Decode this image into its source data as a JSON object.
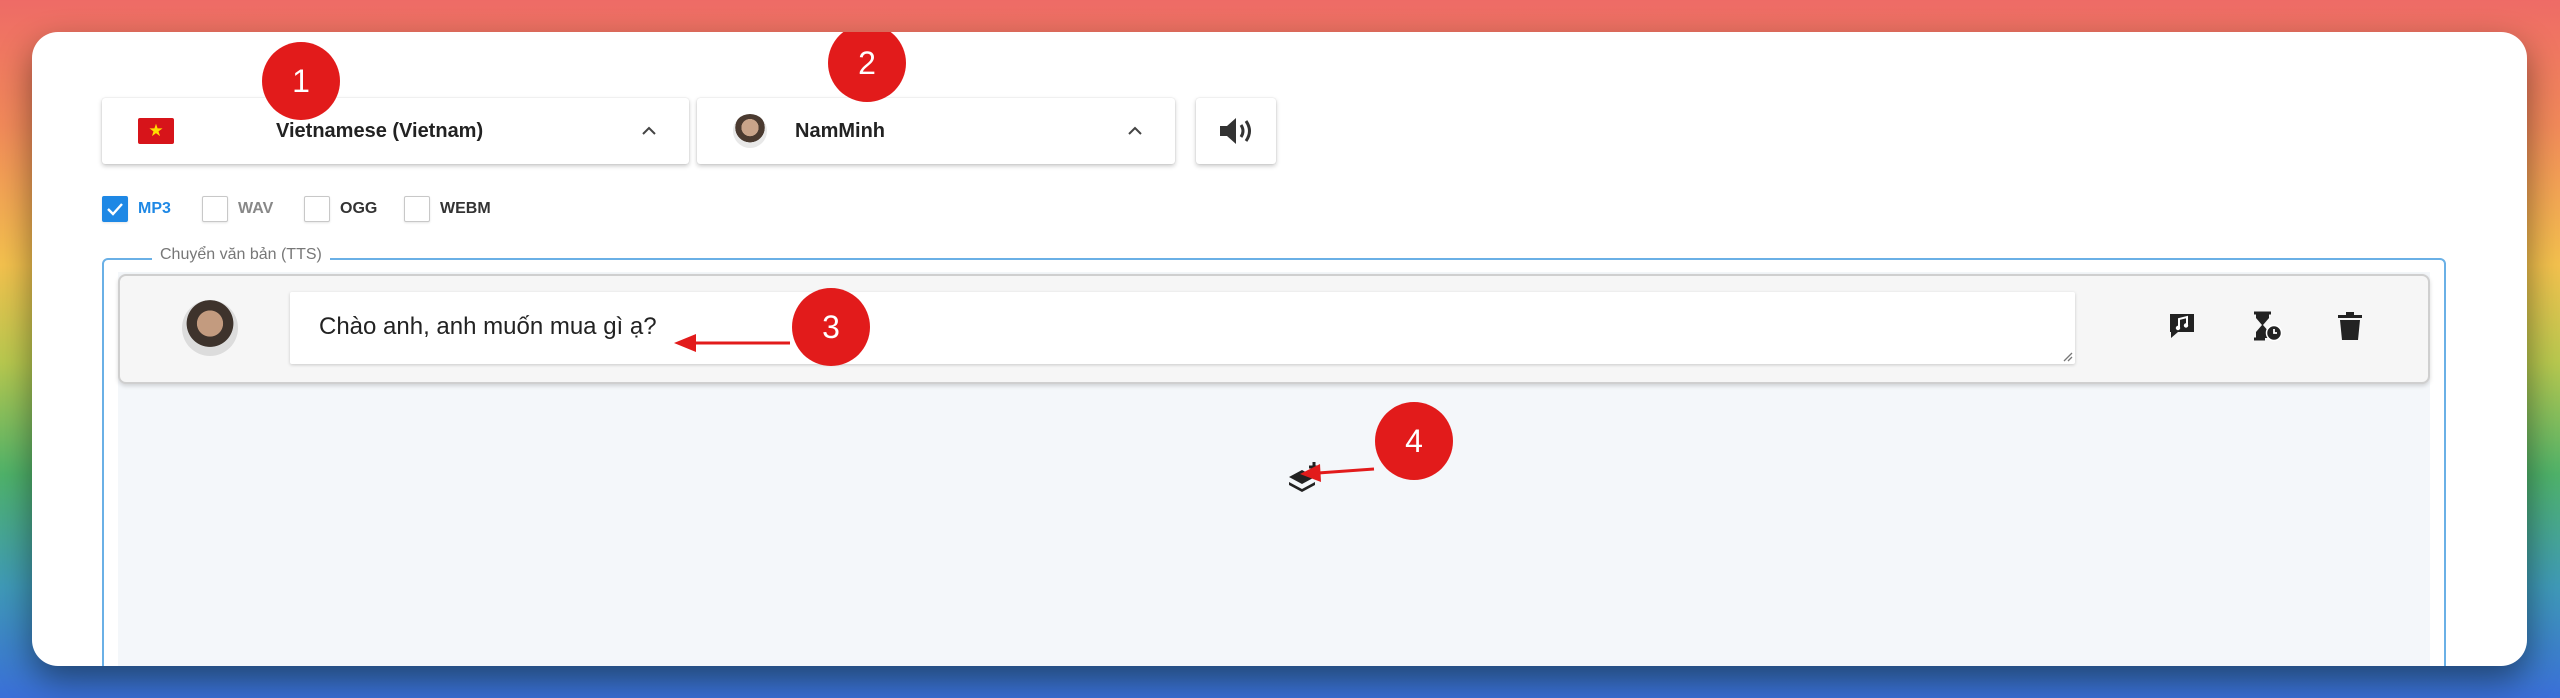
{
  "language_select": {
    "selected": "Vietnamese (Vietnam)",
    "flag": "vietnam-flag",
    "icon": "chevron-up-icon"
  },
  "voice_select": {
    "selected": "NamMinh",
    "icon": "chevron-up-icon"
  },
  "speaker_button": {
    "icon": "speaker-icon"
  },
  "formats": [
    {
      "label": "MP3",
      "checked": true
    },
    {
      "label": "WAV",
      "checked": false
    },
    {
      "label": "OGG",
      "checked": false
    },
    {
      "label": "WEBM",
      "checked": false
    }
  ],
  "tts_panel": {
    "legend": "Chuyển văn bản (TTS)",
    "rows": [
      {
        "text": "Chào anh, anh muốn mua gì ạ?",
        "actions": [
          "comment-music-icon",
          "hourglass-clock-icon",
          "trash-icon"
        ]
      }
    ],
    "add_icon": "layers-plus-icon"
  },
  "annotations": [
    {
      "number": "1"
    },
    {
      "number": "2"
    },
    {
      "number": "3"
    },
    {
      "number": "4"
    }
  ],
  "colors": {
    "accent": "#1e88e5",
    "badge": "#e21b1b",
    "border": "#6ab0e6"
  }
}
